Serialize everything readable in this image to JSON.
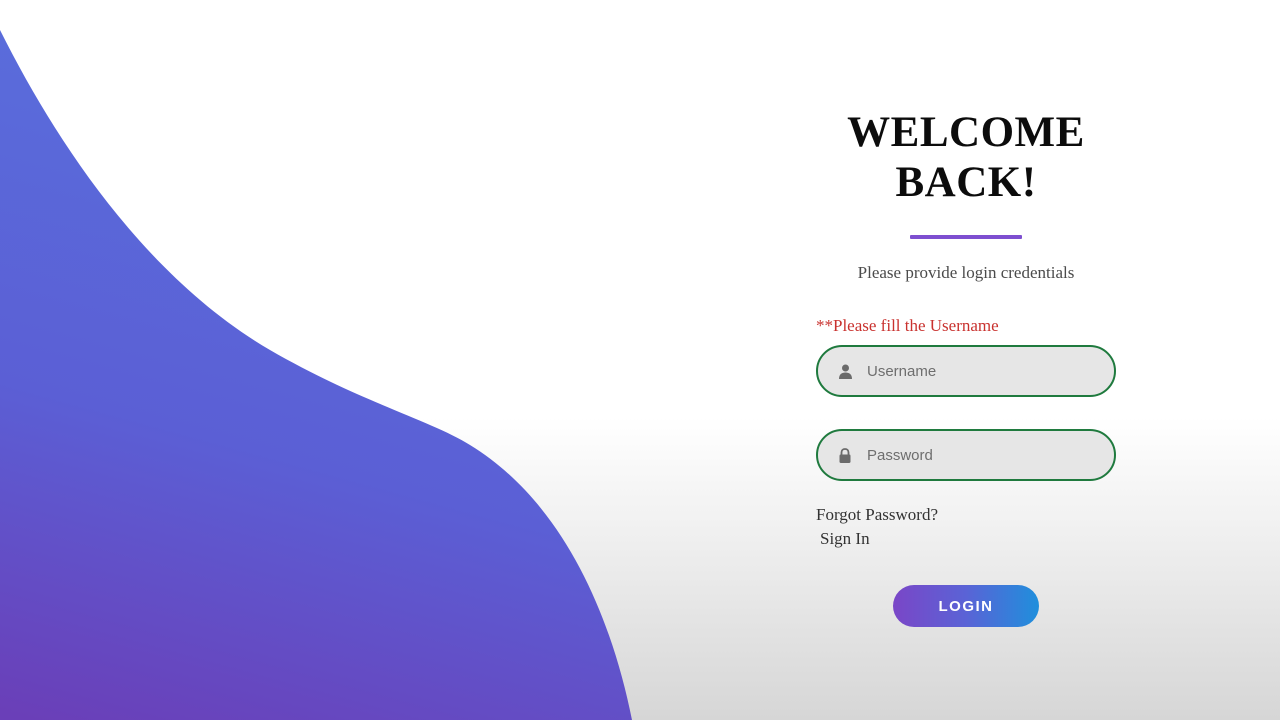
{
  "login": {
    "title_line1": "WELCOME",
    "title_line2": "BACK!",
    "subtitle": "Please provide login credentials",
    "error_message": "**Please fill the Username",
    "username_placeholder": "Username",
    "password_placeholder": "Password",
    "forgot_password": "Forgot Password?",
    "sign_in": "Sign In",
    "login_button": "LOGIN"
  },
  "icons": {
    "username": "user-icon",
    "password": "lock-icon"
  },
  "colors": {
    "wave_gradient_top": "#5a6bdb",
    "wave_gradient_bottom": "#6a3fb8",
    "divider": "#7e4fd0",
    "error": "#c9322f",
    "field_border": "#1f7a3e",
    "button_gradient_start": "#7a46c7",
    "button_gradient_end": "#1f8fdc"
  }
}
